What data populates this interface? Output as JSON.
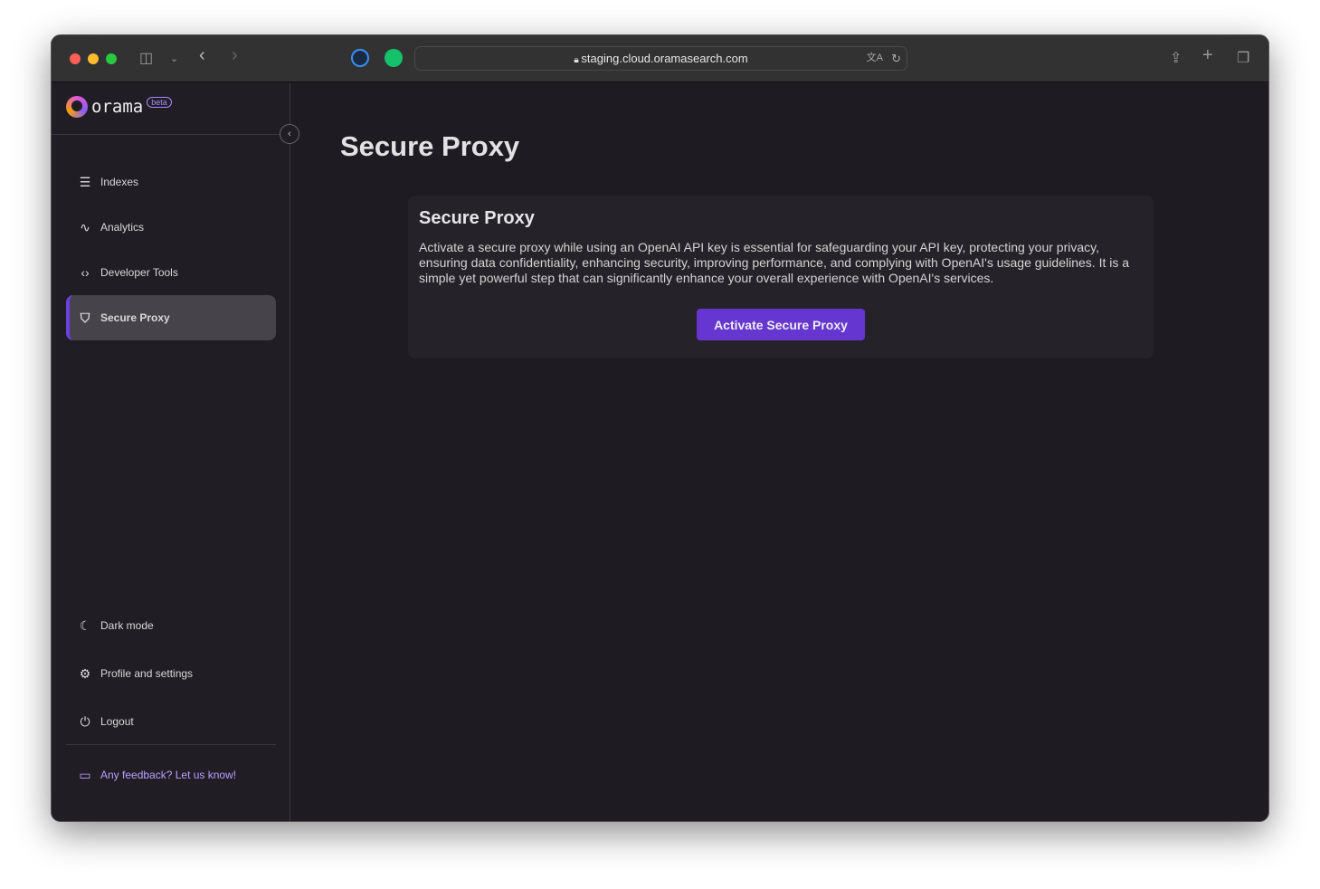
{
  "browser": {
    "url": "staging.cloud.oramasearch.com"
  },
  "brand": {
    "name": "orama",
    "badge": "beta",
    "accent": "#6636d0"
  },
  "sidebar": {
    "items": [
      {
        "label": "Indexes",
        "icon": "database-icon"
      },
      {
        "label": "Analytics",
        "icon": "activity-icon"
      },
      {
        "label": "Developer Tools",
        "icon": "code-icon"
      },
      {
        "label": "Secure Proxy",
        "icon": "shield-icon",
        "active": true
      }
    ],
    "bottom": [
      {
        "label": "Dark mode",
        "icon": "moon-icon"
      },
      {
        "label": "Profile and settings",
        "icon": "gear-icon"
      },
      {
        "label": "Logout",
        "icon": "power-icon"
      }
    ],
    "feedback": "Any feedback? Let us know!"
  },
  "main": {
    "title": "Secure Proxy",
    "card": {
      "title": "Secure Proxy",
      "description": "Activate a secure proxy while using an OpenAI API key is essential for safeguarding your API key, protecting your privacy, ensuring data confidentiality, enhancing security, improving performance, and complying with OpenAI's usage guidelines. It is a simple yet powerful step that can significantly enhance your overall experience with OpenAI's services.",
      "button": "Activate Secure Proxy"
    }
  }
}
